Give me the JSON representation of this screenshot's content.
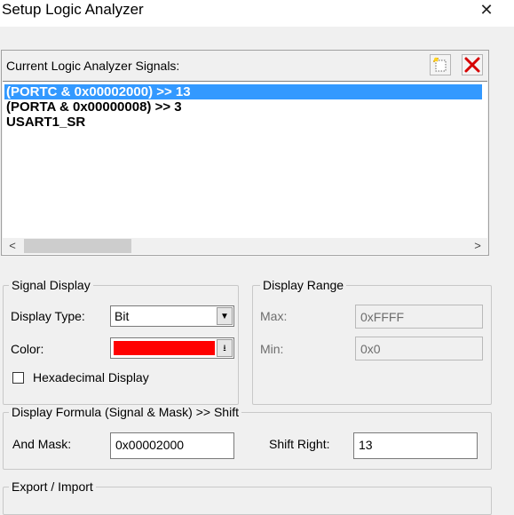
{
  "window": {
    "title": "Setup Logic Analyzer",
    "close_glyph": "✕"
  },
  "signals": {
    "header_label": "Current Logic Analyzer Signals:",
    "new_button_icon": "new-signal-icon",
    "delete_button_icon": "delete-icon",
    "items": [
      {
        "label": "(PORTC & 0x00002000) >> 13",
        "selected": true
      },
      {
        "label": "(PORTA & 0x00000008) >> 3",
        "selected": false
      },
      {
        "label": "USART1_SR",
        "selected": false
      }
    ],
    "scroll_left": "<",
    "scroll_right": ">"
  },
  "signal_display": {
    "legend": "Signal Display",
    "display_type_label": "Display Type:",
    "display_type_value": "Bit",
    "color_label": "Color:",
    "color_value": "#ff0000",
    "hex_display_label": "Hexadecimal Display",
    "hex_display_checked": false
  },
  "display_range": {
    "legend": "Display Range",
    "max_label": "Max:",
    "max_value": "0xFFFF",
    "min_label": "Min:",
    "min_value": "0x0"
  },
  "display_formula": {
    "legend": "Display Formula (Signal & Mask) >> Shift",
    "and_mask_label": "And Mask:",
    "and_mask_value": "0x00002000",
    "shift_right_label": "Shift Right:",
    "shift_right_value": "13"
  },
  "export_import": {
    "legend": "Export / Import"
  }
}
